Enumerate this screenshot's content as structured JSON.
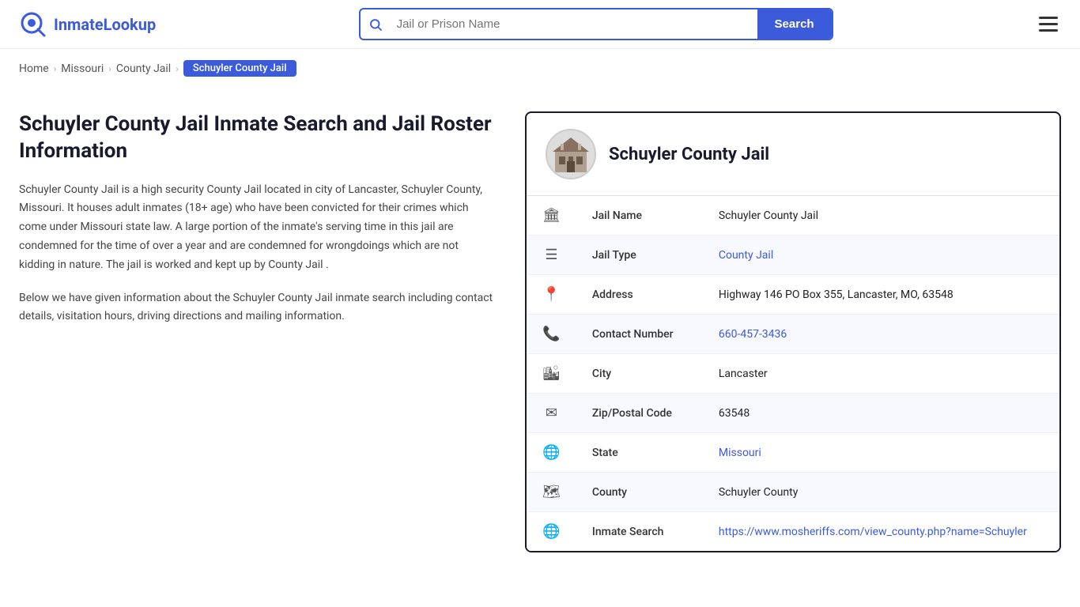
{
  "header": {
    "logo_text_part1": "Inmate",
    "logo_text_part2": "Lookup",
    "search_placeholder": "Jail or Prison Name",
    "search_button_label": "Search",
    "menu_icon": "hamburger-icon"
  },
  "breadcrumb": {
    "home": "Home",
    "state": "Missouri",
    "type": "County Jail",
    "current": "Schuyler County Jail"
  },
  "left": {
    "page_title": "Schuyler County Jail Inmate Search and Jail Roster Information",
    "description1": "Schuyler County Jail is a high security County Jail located in city of Lancaster, Schuyler County, Missouri. It houses adult inmates (18+ age) who have been convicted for their crimes which come under Missouri state law. A large portion of the inmate's serving time in this jail are condemned for the time of over a year and are condemned for wrongdoings which are not kidding in nature. The jail is worked and kept up by County Jail .",
    "description2": "Below we have given information about the Schuyler County Jail inmate search including contact details, visitation hours, driving directions and mailing information."
  },
  "info_card": {
    "jail_name_header": "Schuyler County Jail",
    "rows": [
      {
        "icon": "🏛",
        "label": "Jail Name",
        "value": "Schuyler County Jail",
        "link": null
      },
      {
        "icon": "☰",
        "label": "Jail Type",
        "value": "County Jail",
        "link": "#"
      },
      {
        "icon": "📍",
        "label": "Address",
        "value": "Highway 146 PO Box 355, Lancaster, MO, 63548",
        "link": null
      },
      {
        "icon": "📞",
        "label": "Contact Number",
        "value": "660-457-3436",
        "link": "tel:660-457-3436"
      },
      {
        "icon": "🏙",
        "label": "City",
        "value": "Lancaster",
        "link": null
      },
      {
        "icon": "✉",
        "label": "Zip/Postal Code",
        "value": "63548",
        "link": null
      },
      {
        "icon": "🌐",
        "label": "State",
        "value": "Missouri",
        "link": "#"
      },
      {
        "icon": "🗺",
        "label": "County",
        "value": "Schuyler County",
        "link": null
      },
      {
        "icon": "🌐",
        "label": "Inmate Search",
        "value": "https://www.mosheriffs.com/view_county.php?name=Schuyler",
        "link": "https://www.mosheriffs.com/view_county.php?name=Schuyler"
      }
    ]
  }
}
